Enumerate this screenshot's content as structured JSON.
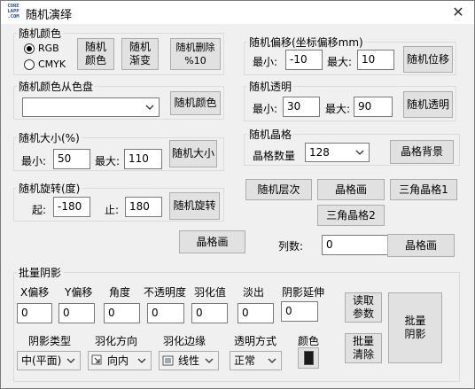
{
  "window": {
    "title": "随机演绎",
    "app_icon_text": "CORE\nLAPP\n.COM"
  },
  "random_color": {
    "group_label": "随机颜色",
    "radio_rgb": "RGB",
    "radio_cmyk": "CMYK",
    "btn_random_color": "随机\n颜色",
    "btn_random_gradient": "随机\n渐变",
    "btn_random_delete": "随机删除\n%10"
  },
  "palette": {
    "group_label": "随机颜色从色盘",
    "combo_value": "",
    "btn_random_color": "随机颜色"
  },
  "offset": {
    "group_label": "随机偏移(坐标偏移mm)",
    "min_label": "最小:",
    "min_value": "-10",
    "max_label": "最大:",
    "max_value": "10",
    "btn": "随机位移"
  },
  "opacity": {
    "group_label": "随机透明",
    "min_label": "最小:",
    "min_value": "30",
    "max_label": "最大:",
    "max_value": "90",
    "btn": "随机透明"
  },
  "size": {
    "group_label": "随机大小(%)",
    "min_label": "最小:",
    "min_value": "50",
    "max_label": "最大:",
    "max_value": "110",
    "btn": "随机大小"
  },
  "grid": {
    "group_label": "随机晶格",
    "count_label": "晶格数量",
    "count_value": "128",
    "btn_background": "晶格背景"
  },
  "rotate": {
    "group_label": "随机旋转(度)",
    "start_label": "起:",
    "start_value": "-180",
    "end_label": "止:",
    "end_value": "180",
    "btn": "随机旋转"
  },
  "middle_buttons": {
    "layer": "随机层次",
    "grid_draw": "晶格画",
    "triangle1": "三角晶格1",
    "triangle2": "三角晶格2"
  },
  "row_grid": {
    "btn_left": "晶格画",
    "columns_label": "列数:",
    "columns_value": "0",
    "btn_right": "晶格画"
  },
  "batch_shadow": {
    "group_label": "批量阴影",
    "headers": [
      "X偏移",
      "Y偏移",
      "角度",
      "不透明度",
      "羽化值",
      "淡出",
      "阴影延伸"
    ],
    "values": [
      "0",
      "0",
      "0",
      "0",
      "0",
      "0",
      "0"
    ],
    "type_label": "阴影类型",
    "type_value": "中(平面)",
    "feather_dir_label": "羽化方向",
    "feather_dir_value": "向内",
    "feather_edge_label": "羽化边缘",
    "feather_edge_value": "线性",
    "transparency_label": "透明方式",
    "transparency_value": "正常",
    "color_label": "颜色",
    "color_swatch": "#1a1a1a",
    "btn_read": "读取\n参数",
    "btn_clear": "批量\n清除",
    "btn_shadow": "批量\n阴影"
  }
}
